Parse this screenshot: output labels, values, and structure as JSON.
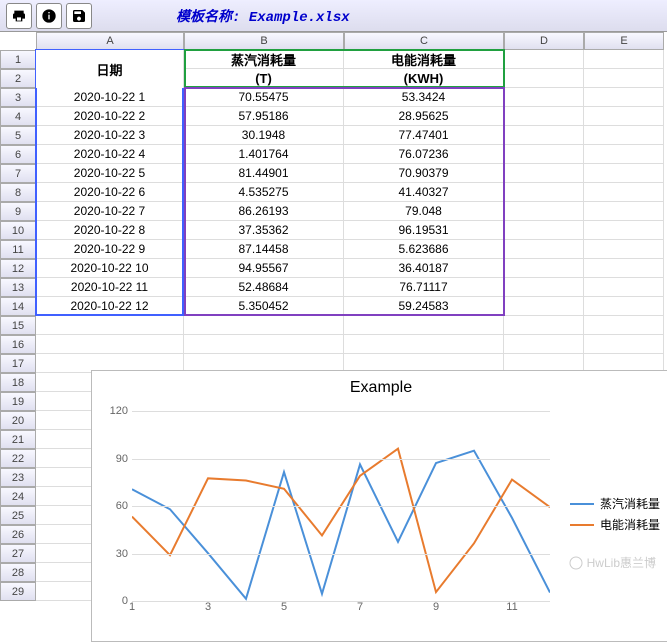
{
  "toolbar": {
    "print_icon": "print",
    "info_icon": "info",
    "save_icon": "save",
    "title_prefix": "模板名称: ",
    "title_value": "Example.xlsx"
  },
  "columns": [
    "A",
    "B",
    "C",
    "D",
    "E"
  ],
  "row_numbers": [
    "1",
    "2",
    "3",
    "4",
    "5",
    "6",
    "7",
    "8",
    "9",
    "10",
    "11",
    "12",
    "13",
    "14",
    "15",
    "16",
    "17",
    "18",
    "19",
    "20",
    "21",
    "22",
    "23",
    "24",
    "25",
    "26",
    "27",
    "28",
    "29"
  ],
  "headers": {
    "A1": "日期",
    "B1": "蒸汽消耗量",
    "B2": "(T)",
    "C1": "电能消耗量",
    "C2": "(KWH)"
  },
  "table_rows": [
    {
      "date": "2020-10-22 1",
      "steam": "70.55475",
      "power": "53.3424"
    },
    {
      "date": "2020-10-22 2",
      "steam": "57.95186",
      "power": "28.95625"
    },
    {
      "date": "2020-10-22 3",
      "steam": "30.1948",
      "power": "77.47401"
    },
    {
      "date": "2020-10-22 4",
      "steam": "1.401764",
      "power": "76.07236"
    },
    {
      "date": "2020-10-22 5",
      "steam": "81.44901",
      "power": "70.90379"
    },
    {
      "date": "2020-10-22 6",
      "steam": "4.535275",
      "power": "41.40327"
    },
    {
      "date": "2020-10-22 7",
      "steam": "86.26193",
      "power": "79.048"
    },
    {
      "date": "2020-10-22 8",
      "steam": "37.35362",
      "power": "96.19531"
    },
    {
      "date": "2020-10-22 9",
      "steam": "87.14458",
      "power": "5.623686"
    },
    {
      "date": "2020-10-22 10",
      "steam": "94.95567",
      "power": "36.40187"
    },
    {
      "date": "2020-10-22 11",
      "steam": "52.48684",
      "power": "76.71117"
    },
    {
      "date": "2020-10-22 12",
      "steam": "5.350452",
      "power": "59.24583"
    }
  ],
  "chart_data": {
    "type": "line",
    "title": "Example",
    "ylim": [
      0,
      120
    ],
    "y_ticks": [
      0,
      30,
      60,
      90,
      120
    ],
    "x_ticks": [
      "1",
      "3",
      "5",
      "7",
      "9",
      "11"
    ],
    "categories": [
      1,
      2,
      3,
      4,
      5,
      6,
      7,
      8,
      9,
      10,
      11,
      12
    ],
    "series": [
      {
        "name": "蒸汽消耗量",
        "color": "#4a90d9",
        "values": [
          70.55,
          57.95,
          30.19,
          1.4,
          81.45,
          4.54,
          86.26,
          37.35,
          87.14,
          94.96,
          52.49,
          5.35
        ]
      },
      {
        "name": "电能消耗量",
        "color": "#e87b2e",
        "values": [
          53.34,
          28.96,
          77.47,
          76.07,
          70.9,
          41.4,
          79.05,
          96.2,
          5.62,
          36.4,
          76.71,
          59.25
        ]
      }
    ]
  },
  "watermark": "HwLib惠兰博"
}
